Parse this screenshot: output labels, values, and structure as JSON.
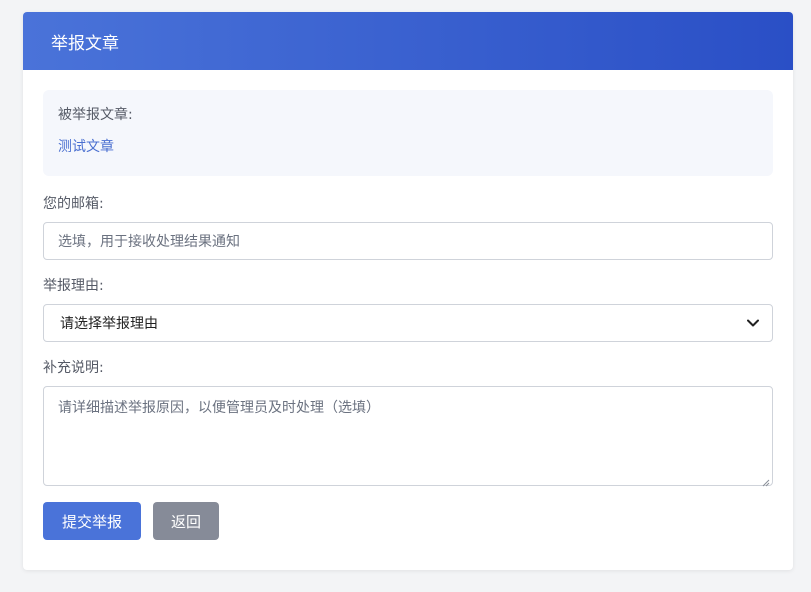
{
  "header": {
    "title": "举报文章"
  },
  "target": {
    "label": "被举报文章:",
    "article_title": "测试文章"
  },
  "form": {
    "email": {
      "label": "您的邮箱:",
      "value": "",
      "placeholder": "选填，用于接收处理结果通知"
    },
    "reason": {
      "label": "举报理由:",
      "selected": "请选择举报理由",
      "chevron_icon": "chevron-down-icon"
    },
    "description": {
      "label": "补充说明:",
      "value": "",
      "placeholder": "请详细描述举报原因，以便管理员及时处理（选填）"
    }
  },
  "actions": {
    "submit_label": "提交举报",
    "back_label": "返回"
  },
  "colors": {
    "header_start": "#4a73d9",
    "header_end": "#2a4fc6",
    "primary": "#4a73d9",
    "secondary": "#868b98",
    "link": "#4a6fd0"
  }
}
